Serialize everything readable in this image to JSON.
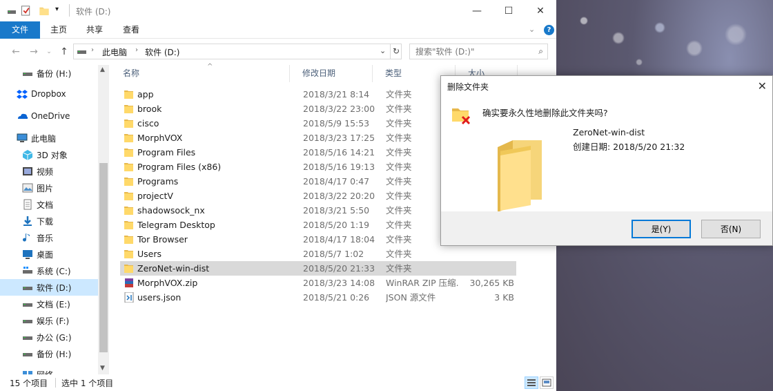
{
  "window": {
    "title": "软件 (D:)",
    "ribbon_tabs": [
      "文件",
      "主页",
      "共享",
      "查看"
    ]
  },
  "address": {
    "crumbs": [
      "此电脑",
      "软件 (D:)"
    ],
    "search_placeholder": "搜索\"软件 (D:)\""
  },
  "nav": {
    "items": [
      {
        "label": "备份 (H:)",
        "icon": "drive-icon"
      },
      {
        "label": "Dropbox",
        "icon": "dropbox-icon"
      },
      {
        "label": "OneDrive",
        "icon": "onedrive-icon"
      },
      {
        "label": "此电脑",
        "icon": "computer-icon"
      },
      {
        "label": "3D 对象",
        "icon": "3d-objects-icon"
      },
      {
        "label": "视频",
        "icon": "video-icon"
      },
      {
        "label": "图片",
        "icon": "pictures-icon"
      },
      {
        "label": "文档",
        "icon": "documents-icon"
      },
      {
        "label": "下载",
        "icon": "download-icon"
      },
      {
        "label": "音乐",
        "icon": "music-icon"
      },
      {
        "label": "桌面",
        "icon": "desktop-icon"
      },
      {
        "label": "系统 (C:)",
        "icon": "system-drive-icon"
      },
      {
        "label": "软件 (D:)",
        "icon": "drive-icon"
      },
      {
        "label": "文档 (E:)",
        "icon": "drive-icon"
      },
      {
        "label": "娱乐 (F:)",
        "icon": "drive-icon"
      },
      {
        "label": "办公 (G:)",
        "icon": "drive-icon"
      },
      {
        "label": "备份 (H:)",
        "icon": "drive-icon"
      },
      {
        "label": "网络",
        "icon": "network-icon"
      }
    ]
  },
  "columns": {
    "name": "名称",
    "date": "修改日期",
    "type": "类型",
    "size": "大小"
  },
  "files": [
    {
      "name": "app",
      "date": "2018/3/21 8:14",
      "type": "文件夹",
      "size": "",
      "icon": "folder-icon"
    },
    {
      "name": "brook",
      "date": "2018/3/22 23:00",
      "type": "文件夹",
      "size": "",
      "icon": "folder-icon"
    },
    {
      "name": "cisco",
      "date": "2018/5/9 15:53",
      "type": "文件夹",
      "size": "",
      "icon": "folder-icon"
    },
    {
      "name": "MorphVOX",
      "date": "2018/3/23 17:25",
      "type": "文件夹",
      "size": "",
      "icon": "folder-icon"
    },
    {
      "name": "Program Files",
      "date": "2018/5/16 14:21",
      "type": "文件夹",
      "size": "",
      "icon": "folder-icon"
    },
    {
      "name": "Program Files (x86)",
      "date": "2018/5/16 19:13",
      "type": "文件夹",
      "size": "",
      "icon": "folder-icon"
    },
    {
      "name": "Programs",
      "date": "2018/4/17 0:47",
      "type": "文件夹",
      "size": "",
      "icon": "folder-icon"
    },
    {
      "name": "projectV",
      "date": "2018/3/22 20:20",
      "type": "文件夹",
      "size": "",
      "icon": "folder-icon"
    },
    {
      "name": "shadowsock_nx",
      "date": "2018/3/21 5:50",
      "type": "文件夹",
      "size": "",
      "icon": "folder-icon"
    },
    {
      "name": "Telegram Desktop",
      "date": "2018/5/20 1:19",
      "type": "文件夹",
      "size": "",
      "icon": "folder-icon"
    },
    {
      "name": "Tor Browser",
      "date": "2018/4/17 18:04",
      "type": "文件夹",
      "size": "",
      "icon": "folder-icon"
    },
    {
      "name": "Users",
      "date": "2018/5/7 1:02",
      "type": "文件夹",
      "size": "",
      "icon": "folder-icon"
    },
    {
      "name": "ZeroNet-win-dist",
      "date": "2018/5/20 21:33",
      "type": "文件夹",
      "size": "",
      "icon": "folder-icon"
    },
    {
      "name": "MorphVOX.zip",
      "date": "2018/3/23 14:08",
      "type": "WinRAR ZIP 压缩...",
      "size": "30,265 KB",
      "icon": "winrar-archive-icon"
    },
    {
      "name": "users.json",
      "date": "2018/5/21 0:26",
      "type": "JSON 源文件",
      "size": "3 KB",
      "icon": "json-file-icon"
    }
  ],
  "status": {
    "count": "15 个项目",
    "selected": "选中 1 个项目"
  },
  "dialog": {
    "title": "删除文件夹",
    "question": "确实要永久性地删除此文件夹吗?",
    "item_name": "ZeroNet-win-dist",
    "created_label": "创建日期: 2018/5/20 21:32",
    "yes_label": "是(Y)",
    "no_label": "否(N)"
  }
}
